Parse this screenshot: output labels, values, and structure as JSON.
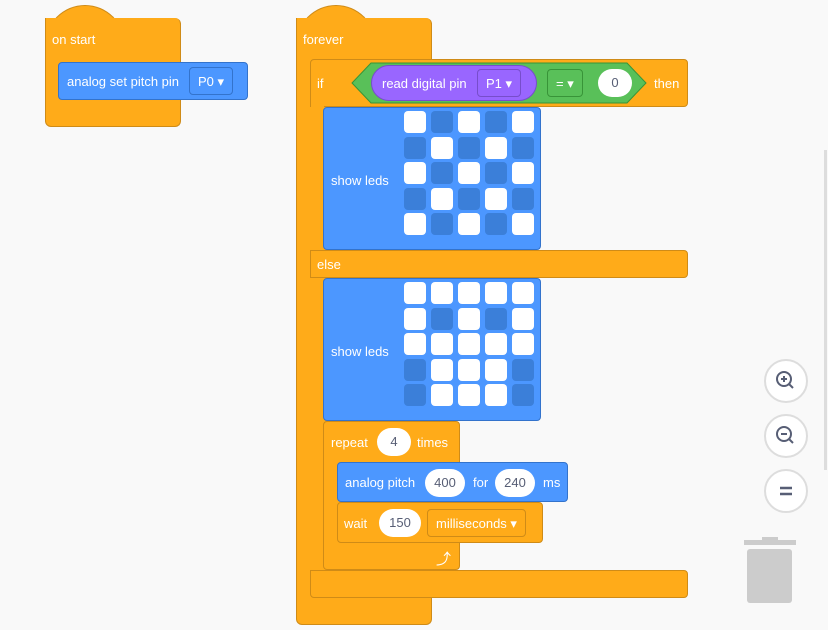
{
  "on_start": {
    "label": "on start",
    "block": {
      "label": "analog set pitch pin",
      "pin": "P0"
    }
  },
  "forever": {
    "label": "forever",
    "if": {
      "label": "if",
      "then": "then",
      "else": "else",
      "condition": {
        "label": "read digital pin",
        "pin": "P1",
        "operator": "=",
        "value": "0"
      }
    },
    "show_leds_1": {
      "label": "show leds",
      "grid": [
        [
          1,
          0,
          1,
          0,
          1
        ],
        [
          0,
          1,
          0,
          1,
          0
        ],
        [
          1,
          0,
          1,
          0,
          1
        ],
        [
          0,
          1,
          0,
          1,
          0
        ],
        [
          1,
          0,
          1,
          0,
          1
        ]
      ]
    },
    "show_leds_2": {
      "label": "show leds",
      "grid": [
        [
          1,
          1,
          1,
          1,
          1
        ],
        [
          1,
          0,
          1,
          0,
          1
        ],
        [
          1,
          1,
          1,
          1,
          1
        ],
        [
          0,
          1,
          1,
          1,
          0
        ],
        [
          0,
          1,
          1,
          1,
          0
        ]
      ]
    },
    "repeat": {
      "label": "repeat",
      "count": "4",
      "suffix": "times"
    },
    "analog_pitch": {
      "label": "analog pitch",
      "freq": "400",
      "for": "for",
      "duration": "240",
      "unit": "ms"
    },
    "wait": {
      "label": "wait",
      "value": "150",
      "unit": "milliseconds"
    }
  },
  "colors": {
    "loops": "#FFAB19",
    "pins": "#4C97FF",
    "logic": "#59C059",
    "input": "#9966FF"
  },
  "controls": {
    "zoom_in": "zoom-in-icon",
    "zoom_out": "zoom-out-icon",
    "reset": "reset-zoom-icon",
    "trash": "trash-icon"
  }
}
